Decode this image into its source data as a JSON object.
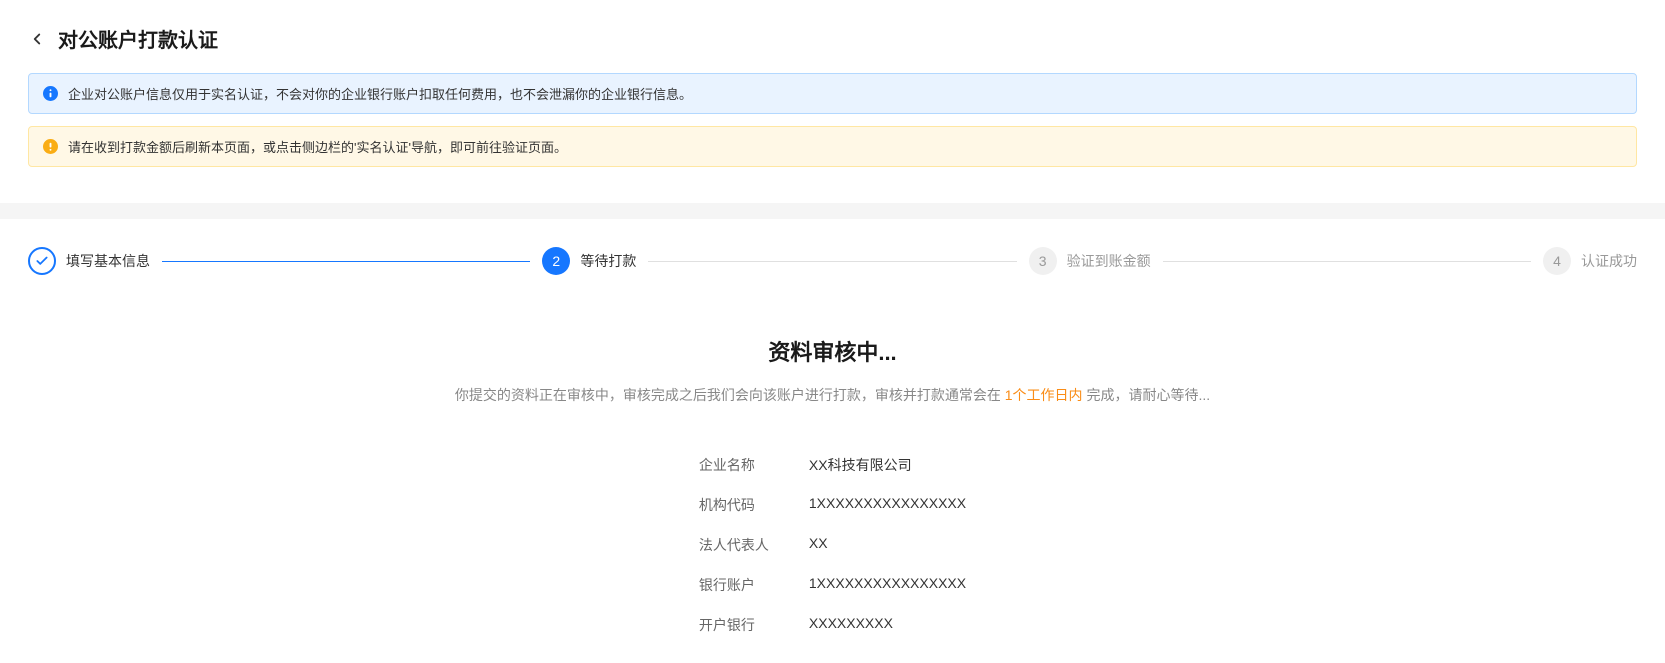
{
  "header": {
    "title": "对公账户打款认证"
  },
  "alerts": {
    "info": "企业对公账户信息仅用于实名认证，不会对你的企业银行账户扣取任何费用，也不会泄漏你的企业银行信息。",
    "warning": "请在收到打款金额后刷新本页面，或点击侧边栏的'实名认证'导航，即可前往验证页面。"
  },
  "steps": [
    {
      "num": "✓",
      "label": "填写基本信息",
      "state": "done"
    },
    {
      "num": "2",
      "label": "等待打款",
      "state": "active"
    },
    {
      "num": "3",
      "label": "验证到账金额",
      "state": "pending"
    },
    {
      "num": "4",
      "label": "认证成功",
      "state": "pending"
    }
  ],
  "review": {
    "title": "资料审核中...",
    "desc_prefix": "你提交的资料正在审核中，审核完成之后我们会向该账户进行打款，审核并打款通常会在 ",
    "desc_highlight": "1个工作日内",
    "desc_suffix": " 完成，请耐心等待..."
  },
  "info": {
    "company_name_label": "企业名称",
    "company_name_value": "XX科技有限公司",
    "org_code_label": "机构代码",
    "org_code_value": "1XXXXXXXXXXXXXXXX",
    "legal_rep_label": "法人代表人",
    "legal_rep_value": "XX",
    "bank_account_label": "银行账户",
    "bank_account_value": "1XXXXXXXXXXXXXXXX",
    "bank_name_label": "开户银行",
    "bank_name_value": "XXXXXXXXX"
  }
}
